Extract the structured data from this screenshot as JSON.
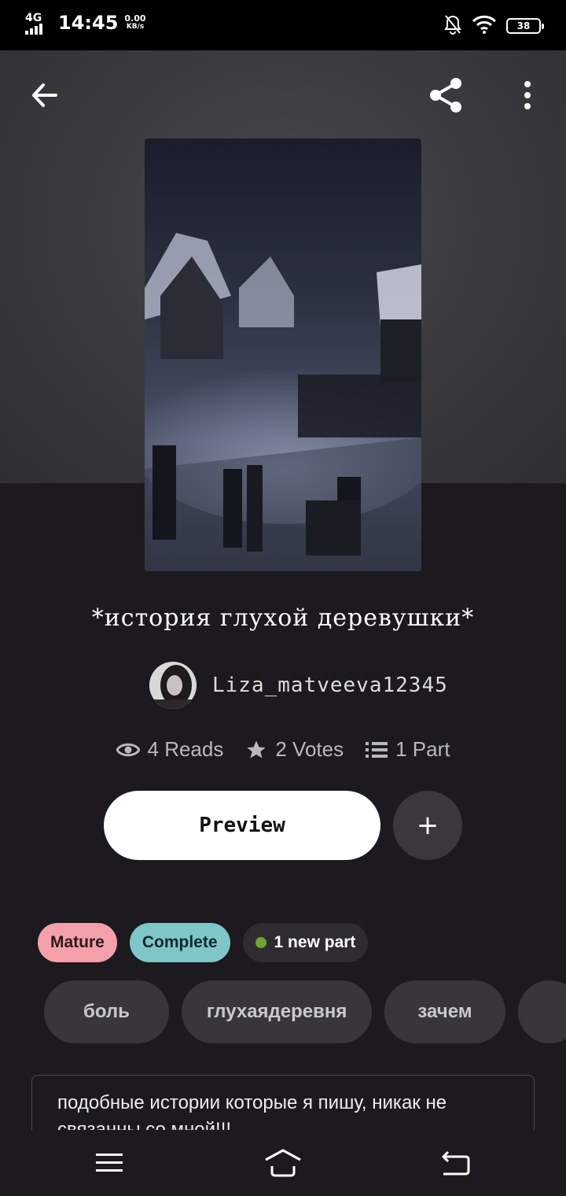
{
  "status": {
    "network": "4G",
    "time": "14:45",
    "speed_value": "0.00",
    "speed_unit": "KB/s",
    "battery": "38"
  },
  "story": {
    "title": "*история глухой деревушки*",
    "author": "Liza_matveeva12345",
    "reads": "4 Reads",
    "votes": "2 Votes",
    "parts": "1 Part"
  },
  "actions": {
    "preview_label": "Preview",
    "add_label": "+"
  },
  "badges": {
    "mature": "Mature",
    "complete": "Complete",
    "new_part": "1 new part"
  },
  "tags": [
    "боль",
    "глухаядеревня",
    "зачем"
  ],
  "description": "подобные истории которые я пишу, никак не связанны со мной!!!",
  "colors": {
    "background": "#1c1a1e",
    "mature": "#f4a0aa",
    "complete": "#7ec6c8",
    "new_dot": "#6aa733"
  },
  "icons": {
    "back": "arrow-left-icon",
    "share": "share-icon",
    "more": "more-vertical-icon",
    "reads": "eye-icon",
    "votes": "star-icon",
    "parts": "list-icon"
  }
}
